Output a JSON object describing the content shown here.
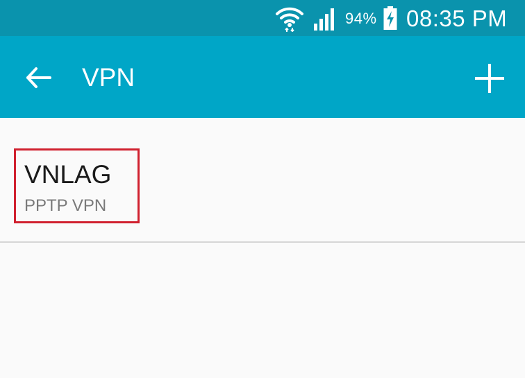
{
  "status_bar": {
    "battery_percent": "94%",
    "time": "08:35 PM",
    "icons": [
      "wifi-icon",
      "signal-icon",
      "battery-charging-icon"
    ]
  },
  "app_bar": {
    "title": "VPN",
    "back_icon": "arrow-back-icon",
    "add_icon": "plus-icon"
  },
  "vpn_list": [
    {
      "name": "VNLAG",
      "type": "PPTP VPN"
    }
  ],
  "colors": {
    "status_bar": "#0a93ad",
    "app_bar": "#00a6c7",
    "background": "#fafafa",
    "highlight_border": "#d0202e"
  }
}
